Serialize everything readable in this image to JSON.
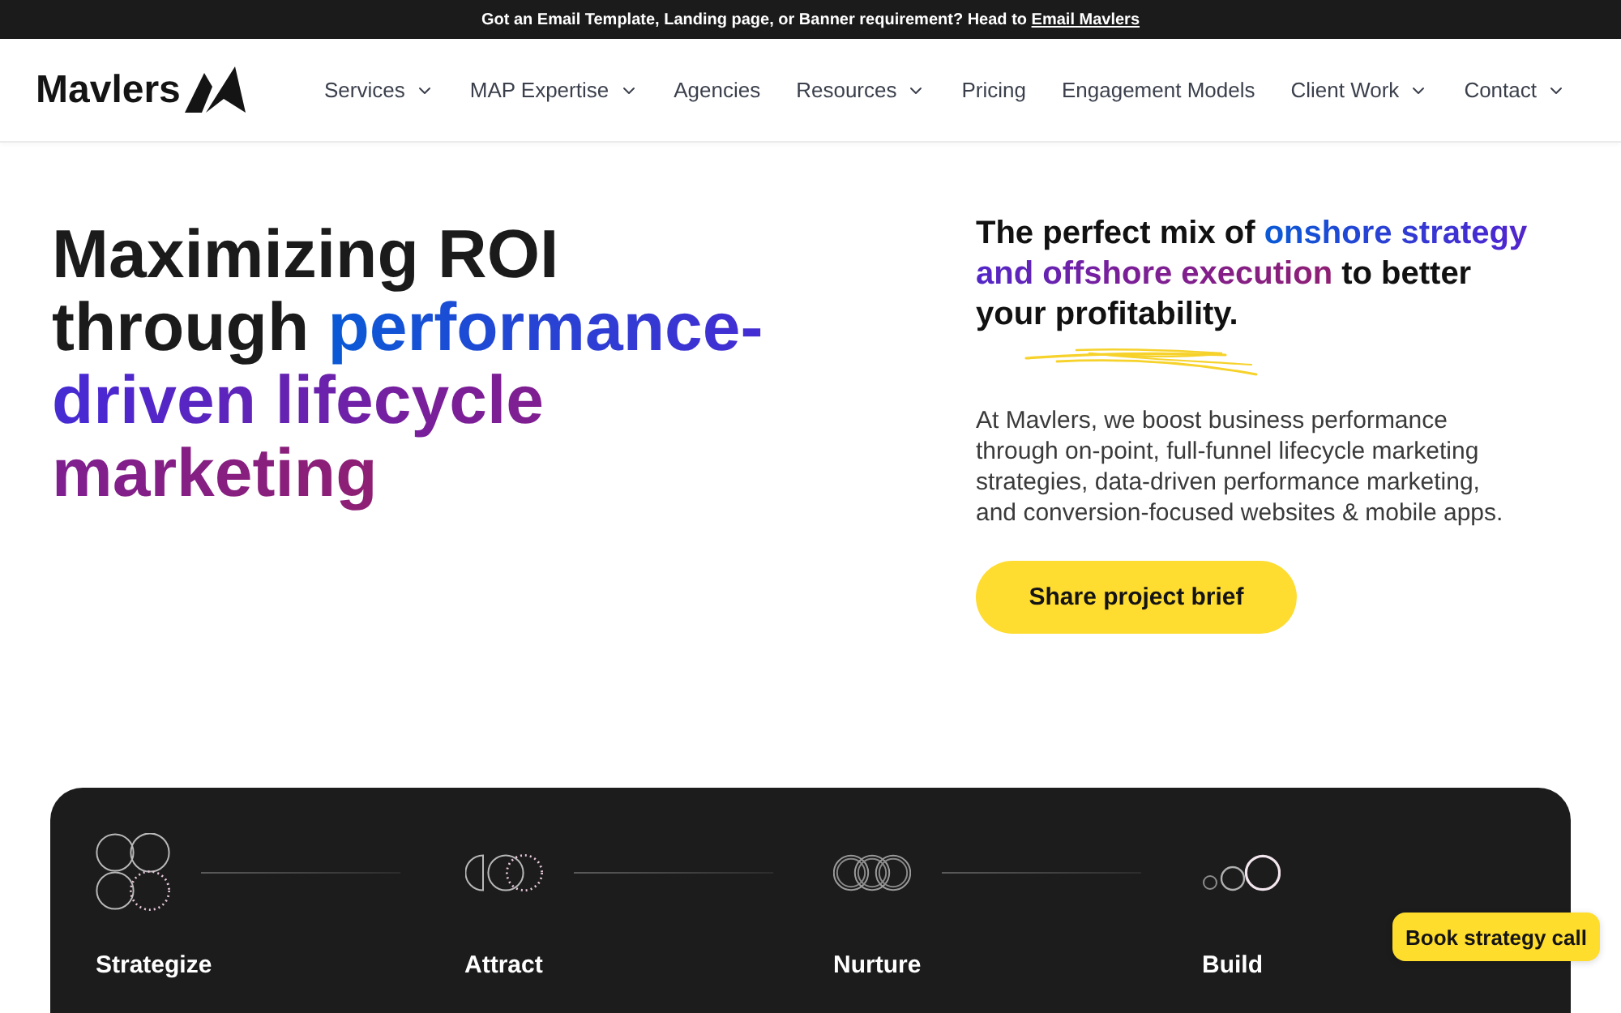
{
  "announcement": {
    "text": "Got an Email Template, Landing page, or Banner requirement? Head to",
    "link": "Email Mavlers"
  },
  "header": {
    "logo": "Mavlers",
    "nav": [
      {
        "label": "Services",
        "dropdown": true
      },
      {
        "label": "MAP Expertise",
        "dropdown": true
      },
      {
        "label": "Agencies",
        "dropdown": false
      },
      {
        "label": "Resources",
        "dropdown": true
      },
      {
        "label": "Pricing",
        "dropdown": false
      },
      {
        "label": "Engagement Models",
        "dropdown": false
      },
      {
        "label": "Client Work",
        "dropdown": true
      },
      {
        "label": "Contact",
        "dropdown": true
      }
    ]
  },
  "hero": {
    "headline": [
      {
        "text": "Maximizing ROI through",
        "accent": false
      },
      {
        "text": "performance-driven lifecycle marketing",
        "accent": true
      }
    ],
    "tagline": [
      {
        "text": "The perfect mix of",
        "accent": false
      },
      {
        "text": "onshore strategy and offshore execution",
        "accent": true
      },
      {
        "text": "to better your profitability.",
        "accent": false
      }
    ],
    "description": "At Mavlers, we boost business performance through on-point, full-funnel lifecycle marketing strategies, data-driven performance marketing, and conversion-focused websites & mobile apps.",
    "cta": "Share project brief"
  },
  "process": {
    "steps": [
      {
        "label": "Strategize",
        "kind": "quad"
      },
      {
        "label": "Attract",
        "kind": "split"
      },
      {
        "label": "Nurture",
        "kind": "rings"
      },
      {
        "label": "Build",
        "kind": "growth"
      }
    ]
  },
  "chat_button": "Book strategy call"
}
